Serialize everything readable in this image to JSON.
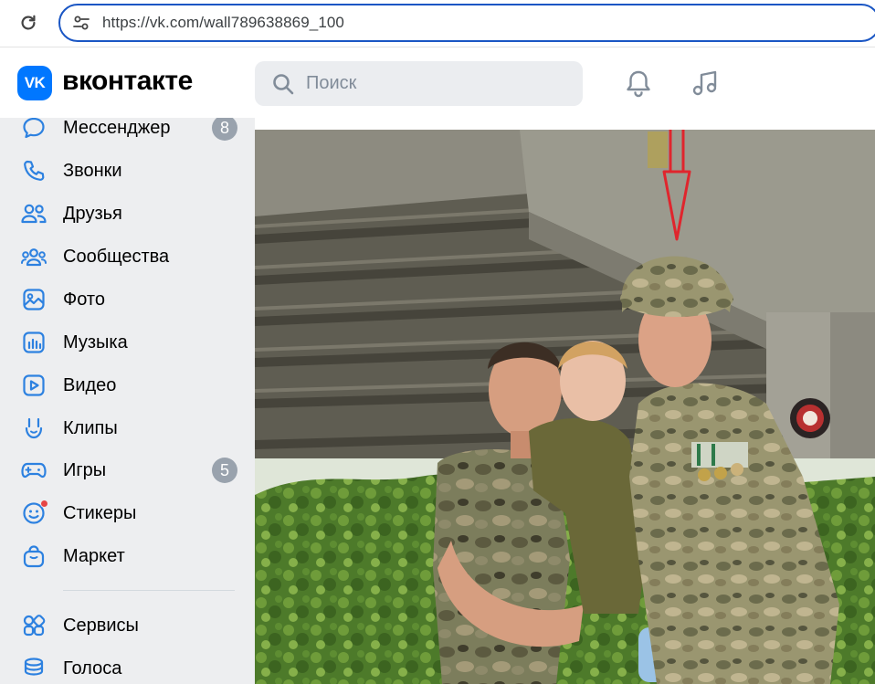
{
  "browser": {
    "url": "https://vk.com/wall789638869_100"
  },
  "header": {
    "logo_text": "VK",
    "wordmark": "вконтакте",
    "search_placeholder": "Поиск",
    "icons": [
      "bell-icon",
      "music-note-icon"
    ]
  },
  "sidebar": {
    "items": [
      {
        "label": "Мессенджер",
        "icon": "message-bubble-icon",
        "badge": "8"
      },
      {
        "label": "Звонки",
        "icon": "phone-icon"
      },
      {
        "label": "Друзья",
        "icon": "friends-icon"
      },
      {
        "label": "Сообщества",
        "icon": "communities-icon"
      },
      {
        "label": "Фото",
        "icon": "photo-icon"
      },
      {
        "label": "Музыка",
        "icon": "music-bars-icon"
      },
      {
        "label": "Видео",
        "icon": "video-play-icon"
      },
      {
        "label": "Клипы",
        "icon": "clips-hand-icon"
      },
      {
        "label": "Игры",
        "icon": "gamepad-icon",
        "badge": "5"
      },
      {
        "label": "Стикеры",
        "icon": "smile-icon",
        "dot": true
      },
      {
        "label": "Маркет",
        "icon": "bag-icon"
      },
      {
        "label": "Сервисы",
        "icon": "services-grid-icon"
      },
      {
        "label": "Голоса",
        "icon": "coins-stack-icon"
      }
    ]
  },
  "colors": {
    "accent": "#0077ff",
    "nav_icon": "#2d81e0",
    "sidebar_bg": "#edeef0",
    "badge_bg": "#99a2ad",
    "arrow_red": "#e0252d"
  },
  "photo": {
    "description_icon": "photo-image",
    "annotation": "red-down-arrow"
  }
}
